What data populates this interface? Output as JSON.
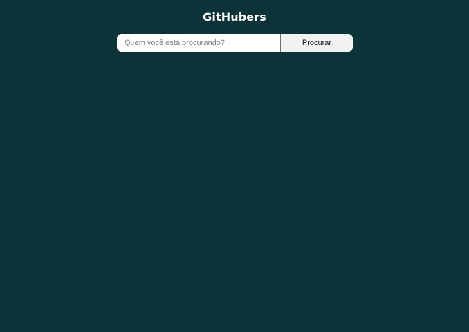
{
  "app": {
    "title": "GitHubers"
  },
  "search": {
    "placeholder": "Quem você está procurando?",
    "value": "",
    "button_label": "Procurar"
  },
  "colors": {
    "background": "#0b3338",
    "title_text": "#ffffff",
    "input_background": "#ffffff",
    "button_background": "#f1f3f3"
  }
}
